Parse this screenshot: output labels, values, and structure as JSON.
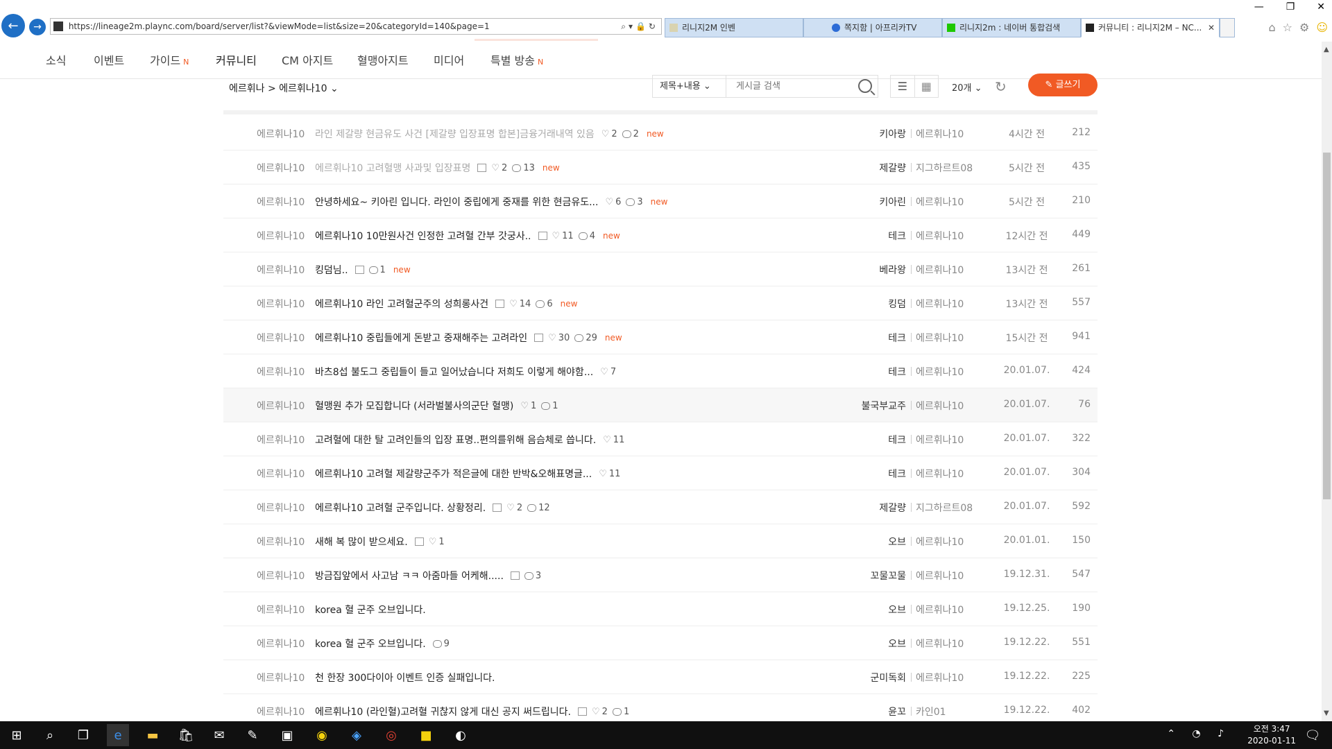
{
  "browser": {
    "url": "https://lineage2m.plaync.com/board/server/list?&viewMode=list&size=20&categoryId=140&page=1",
    "tabs": [
      {
        "label": "리니지2M 인벤",
        "active": false
      },
      {
        "label": "쪽지함 | 아프리카TV",
        "active": false
      },
      {
        "label": "리니지2m : 네이버 통합검색",
        "active": false
      },
      {
        "label": "커뮤니티 : 리니지2M – NC...",
        "active": true
      }
    ],
    "window_controls": [
      "—",
      "❐",
      "✕"
    ]
  },
  "site_nav": [
    {
      "label": "소식",
      "badge": ""
    },
    {
      "label": "이벤트",
      "badge": ""
    },
    {
      "label": "가이드",
      "badge": "N"
    },
    {
      "label": "커뮤니티",
      "badge": ""
    },
    {
      "label": "CM 아지트",
      "badge": ""
    },
    {
      "label": "혈맹아지트",
      "badge": ""
    },
    {
      "label": "미디어",
      "badge": ""
    },
    {
      "label": "특별 방송",
      "badge": "N"
    }
  ],
  "board": {
    "breadcrumb": "에르휘나 > 에르휘나10",
    "filter": "제목+내용",
    "search_placeholder": "게시글 검색",
    "page_size": "20개",
    "write_label": "글쓰기"
  },
  "posts": [
    {
      "cat": "에르휘나10",
      "title": "라인 제갈량 현금유도 사건 [제갈량 입장표명 합본]금융거래내역 있음",
      "read": true,
      "img": false,
      "likes": "2",
      "comments": "2",
      "new": "new",
      "author": "키아랑",
      "server": "에르휘나10",
      "time": "4시간 전",
      "views": "212"
    },
    {
      "cat": "에르휘나10",
      "title": "에르휘나10 고려혈맹 사과및 입장표명",
      "read": true,
      "img": true,
      "likes": "2",
      "comments": "13",
      "new": "new",
      "author": "제갈량",
      "server": "지그하르트08",
      "time": "5시간 전",
      "views": "435"
    },
    {
      "cat": "에르휘나10",
      "title": "안녕하세요~ 키아린 입니다. 라인이 중립에게 중재를 위한 현금유도...",
      "read": false,
      "img": false,
      "likes": "6",
      "comments": "3",
      "new": "new",
      "author": "키아린",
      "server": "에르휘나10",
      "time": "5시간 전",
      "views": "210"
    },
    {
      "cat": "에르휘나10",
      "title": "에르휘나10 10만원사건 인정한 고려혈 간부 갓궁사..",
      "read": false,
      "img": true,
      "likes": "11",
      "comments": "4",
      "new": "new",
      "author": "테크",
      "server": "에르휘나10",
      "time": "12시간 전",
      "views": "449"
    },
    {
      "cat": "에르휘나10",
      "title": "킹덤님..",
      "read": false,
      "img": true,
      "likes": "",
      "comments": "1",
      "new": "new",
      "author": "베라왕",
      "server": "에르휘나10",
      "time": "13시간 전",
      "views": "261"
    },
    {
      "cat": "에르휘나10",
      "title": "에르휘나10 라인 고려혈군주의 성희롱사건",
      "read": false,
      "img": true,
      "likes": "14",
      "comments": "6",
      "new": "new",
      "author": "킹덤",
      "server": "에르휘나10",
      "time": "13시간 전",
      "views": "557"
    },
    {
      "cat": "에르휘나10",
      "title": "에르휘나10 중립들에게 돈받고 중재해주는 고려라인",
      "read": false,
      "img": true,
      "likes": "30",
      "comments": "29",
      "new": "new",
      "author": "테크",
      "server": "에르휘나10",
      "time": "15시간 전",
      "views": "941"
    },
    {
      "cat": "에르휘나10",
      "title": "바츠8섭 불도그 중립들이 들고 일어났습니다 저희도 이렇게 해야함...",
      "read": false,
      "img": false,
      "likes": "7",
      "comments": "",
      "new": "",
      "author": "테크",
      "server": "에르휘나10",
      "time": "20.01.07.",
      "views": "424"
    },
    {
      "cat": "에르휘나10",
      "title": "혈맹원 추가 모집합니다 (서라벌불사의군단 혈맹)",
      "read": false,
      "img": false,
      "likes": "1",
      "comments": "1",
      "new": "",
      "author": "불국부교주",
      "server": "에르휘나10",
      "time": "20.01.07.",
      "views": "76",
      "highlight": true
    },
    {
      "cat": "에르휘나10",
      "title": "고려혈에 대한 탈 고려인들의 입장 표명..편의를위해 음슴체로 씁니다.",
      "read": false,
      "img": false,
      "likes": "11",
      "comments": "",
      "new": "",
      "author": "테크",
      "server": "에르휘나10",
      "time": "20.01.07.",
      "views": "322"
    },
    {
      "cat": "에르휘나10",
      "title": "에르휘나10 고려혈 제갈량군주가 적은글에 대한 반박&오해표명글...",
      "read": false,
      "img": false,
      "likes": "11",
      "comments": "",
      "new": "",
      "author": "테크",
      "server": "에르휘나10",
      "time": "20.01.07.",
      "views": "304"
    },
    {
      "cat": "에르휘나10",
      "title": "에르휘나10 고려혈 군주입니다. 상황정리.",
      "read": false,
      "img": true,
      "likes": "2",
      "comments": "12",
      "new": "",
      "author": "제갈량",
      "server": "지그하르트08",
      "time": "20.01.07.",
      "views": "592"
    },
    {
      "cat": "에르휘나10",
      "title": "새해 복 많이 받으세요.",
      "read": false,
      "img": true,
      "likes": "1",
      "comments": "",
      "new": "",
      "author": "오브",
      "server": "에르휘나10",
      "time": "20.01.01.",
      "views": "150"
    },
    {
      "cat": "에르휘나10",
      "title": "방금집앞에서 사고남 ㅋㅋ 아줌마들 어케해.....",
      "read": false,
      "img": true,
      "likes": "",
      "comments": "3",
      "new": "",
      "author": "꼬물꼬물",
      "server": "에르휘나10",
      "time": "19.12.31.",
      "views": "547"
    },
    {
      "cat": "에르휘나10",
      "title": "korea 혈 군주 오브입니다.",
      "read": false,
      "img": false,
      "likes": "",
      "comments": "",
      "new": "",
      "author": "오브",
      "server": "에르휘나10",
      "time": "19.12.25.",
      "views": "190"
    },
    {
      "cat": "에르휘나10",
      "title": "korea 혈 군주 오브입니다.",
      "read": false,
      "img": false,
      "likes": "",
      "comments": "9",
      "new": "",
      "author": "오브",
      "server": "에르휘나10",
      "time": "19.12.22.",
      "views": "551"
    },
    {
      "cat": "에르휘나10",
      "title": "천 한장 300다이아 이벤트 인증 실패입니다.",
      "read": false,
      "img": false,
      "likes": "",
      "comments": "",
      "new": "",
      "author": "군미독회",
      "server": "에르휘나10",
      "time": "19.12.22.",
      "views": "225"
    },
    {
      "cat": "에르휘나10",
      "title": "에르휘나10 (라인혈)고려혈 귀찮지 않게 대신 공지 써드립니다.",
      "read": false,
      "img": true,
      "likes": "2",
      "comments": "1",
      "new": "",
      "author": "윤꼬",
      "server": "카인01",
      "time": "19.12.22.",
      "views": "402"
    }
  ],
  "taskbar": {
    "time": "오전 3:47",
    "date": "2020-01-11"
  },
  "colors": {
    "accent": "#f15a24",
    "ie_blue": "#1f6fc5"
  }
}
